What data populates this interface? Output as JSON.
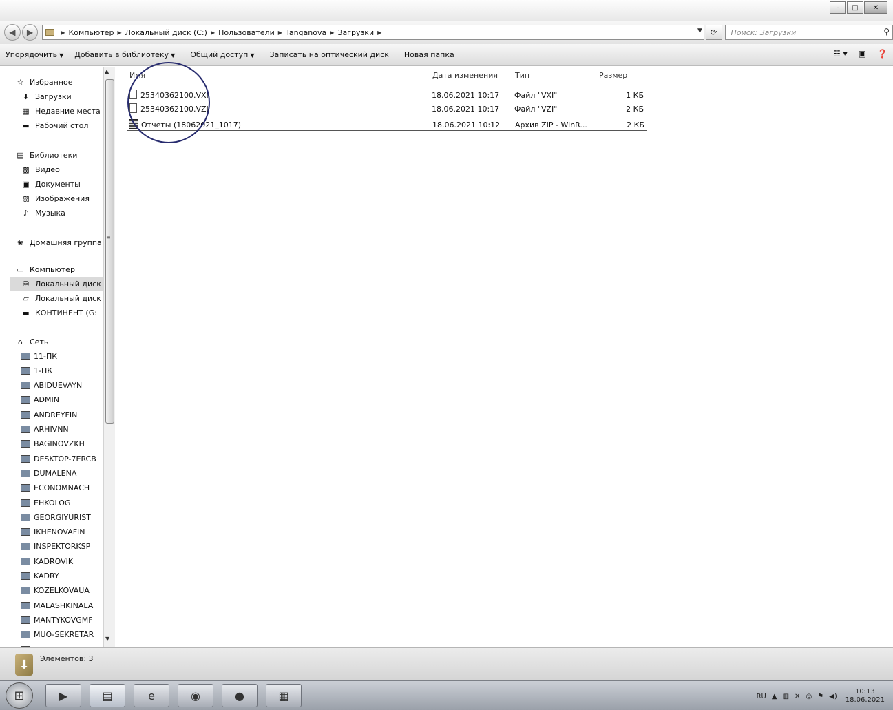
{
  "window": {
    "minimize": "–",
    "maximize": "□",
    "close": "✕"
  },
  "address": {
    "crumbs": [
      "Компьютер",
      "Локальный диск (C:)",
      "Пользователи",
      "Tanganova",
      "Загрузки"
    ],
    "search_placeholder": "Поиск: Загрузки"
  },
  "toolbar": {
    "organize": "Упорядочить",
    "add_to_library": "Добавить в библиотеку",
    "share": "Общий доступ",
    "burn": "Записать на оптический диск",
    "new_folder": "Новая папка"
  },
  "navigation": {
    "favorites": {
      "header": "Избранное",
      "items": [
        "Загрузки",
        "Недавние места",
        "Рабочий стол"
      ]
    },
    "libraries": {
      "header": "Библиотеки",
      "items": [
        "Видео",
        "Документы",
        "Изображения",
        "Музыка"
      ]
    },
    "homegroup": "Домашняя группа",
    "computer": {
      "header": "Компьютер",
      "items": [
        "Локальный диск",
        "Локальный диск",
        "КОНТИНЕНТ (G:"
      ]
    },
    "network": {
      "header": "Сеть",
      "items": [
        "11-ПК",
        "1-ПК",
        "ABIDUEVAYN",
        "ADMIN",
        "ANDREYFIN",
        "ARHIVNN",
        "BAGINOVZKH",
        "DESKTOP-7ERCB",
        "DUMALENA",
        "ECONOMNACH",
        "EHKOLOG",
        "GEORGIYURIST",
        "IKHENOVAFIN",
        "INSPEKTORKSP",
        "KADROVIK",
        "KADRY",
        "KOZELKOVAUA",
        "MALASHKINALA",
        "MANTYKOVGMF",
        "MUO-SEKRETAR",
        "NACHFIN"
      ]
    }
  },
  "columns": {
    "name": "Имя",
    "date": "Дата изменения",
    "type": "Тип",
    "size": "Размер"
  },
  "files": [
    {
      "name": "25340362100.VXI",
      "date": "18.06.2021 10:17",
      "type": "Файл \"VXI\"",
      "size": "1 КБ"
    },
    {
      "name": "25340362100.VZI",
      "date": "18.06.2021 10:17",
      "type": "Файл \"VZI\"",
      "size": "2 КБ"
    },
    {
      "name": "Отчеты (18062021_1017)",
      "date": "18.06.2021 10:12",
      "type": "Архив ZIP - WinR...",
      "size": "2 КБ"
    }
  ],
  "status": {
    "items_count": "Элементов: 3"
  },
  "taskbar": {
    "lang": "RU",
    "time": "10:13",
    "date": "18.06.2021"
  }
}
